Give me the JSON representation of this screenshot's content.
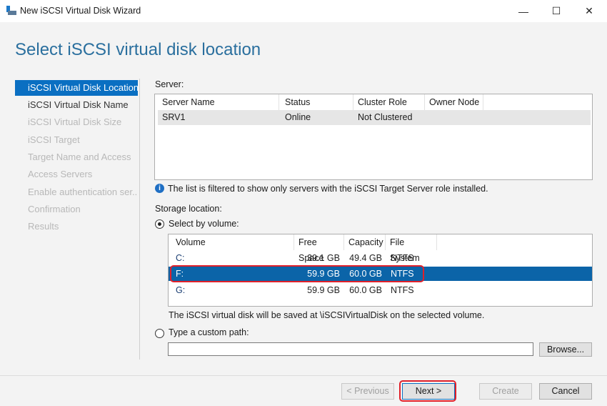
{
  "window": {
    "title": "New iSCSI Virtual Disk Wizard",
    "minimize": "—",
    "maximize": "☐",
    "close": "✕"
  },
  "page_title": "Select iSCSI virtual disk location",
  "nav": [
    "iSCSI Virtual Disk Location",
    "iSCSI Virtual Disk Name",
    "iSCSI Virtual Disk Size",
    "iSCSI Target",
    "Target Name and Access",
    "Access Servers",
    "Enable authentication ser...",
    "Confirmation",
    "Results"
  ],
  "server": {
    "label": "Server:",
    "columns": [
      "Server Name",
      "Status",
      "Cluster Role",
      "Owner Node"
    ],
    "rows": [
      [
        "SRV1",
        "Online",
        "Not Clustered",
        ""
      ]
    ],
    "info": "The list is filtered to show only servers with the iSCSI Target Server role installed."
  },
  "storage": {
    "label": "Storage location:",
    "by_volume": "Select by volume:",
    "columns": [
      "Volume",
      "Free Space",
      "Capacity",
      "File System"
    ],
    "rows": [
      [
        "C:",
        "39.1 GB",
        "49.4 GB",
        "NTFS"
      ],
      [
        "F:",
        "59.9 GB",
        "60.0 GB",
        "NTFS"
      ],
      [
        "G:",
        "59.9 GB",
        "60.0 GB",
        "NTFS"
      ]
    ],
    "note": "The iSCSI virtual disk will be saved at \\iSCSIVirtualDisk on the selected volume.",
    "custom": "Type a custom path:",
    "custom_value": "",
    "browse": "Browse..."
  },
  "buttons": {
    "previous": "< Previous",
    "next": "Next >",
    "create": "Create",
    "cancel": "Cancel"
  },
  "colors": {
    "accent": "#0a6fc2",
    "highlight": "#e0202a"
  }
}
